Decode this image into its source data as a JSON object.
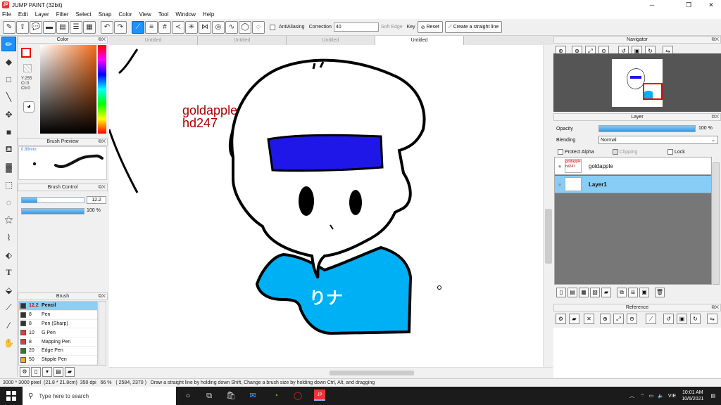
{
  "window": {
    "title": "JUMP PAINT (32bit)",
    "app_icon": "JP"
  },
  "menu": [
    "File",
    "Edit",
    "Layer",
    "Filter",
    "Select",
    "Snap",
    "Color",
    "View",
    "Tool",
    "Window",
    "Help"
  ],
  "toolbar": {
    "antialiasing_label": "AntiAliasing",
    "correction_label": "Correction",
    "correction_value": "40",
    "soft_edge_label": "Soft Edge",
    "key_label": "Key",
    "reset_label": "Reset",
    "straight_line_label": "Create a straight line"
  },
  "tabs": [
    "Untitled",
    "Untitled",
    "Untitled",
    "Untitled"
  ],
  "color_panel": {
    "title": "Color",
    "rgb": [
      "Y:255",
      "Cr:0",
      "Cb:0"
    ],
    "fg_color": "#ffffff",
    "accent": "#f26a18"
  },
  "brush_preview": {
    "title": "Brush Preview",
    "size": "0.89mm"
  },
  "brush_control": {
    "title": "Brush Control",
    "size": "12.2",
    "size_fraction": 0.25,
    "opacity": "100 %",
    "opacity_fraction": 1.0
  },
  "brush_panel": {
    "title": "Brush",
    "items": [
      {
        "size": "12.2",
        "name": "Pencil",
        "color": "#333333",
        "selected": true
      },
      {
        "size": "8",
        "name": "Pen",
        "color": "#333333",
        "selected": false
      },
      {
        "size": "8",
        "name": "Pen (Sharp)",
        "color": "#333333",
        "selected": false
      },
      {
        "size": "10",
        "name": "G Pen",
        "color": "#e53935",
        "selected": false
      },
      {
        "size": "8",
        "name": "Mapping Pen",
        "color": "#e53935",
        "selected": false
      },
      {
        "size": "20",
        "name": "Edge Pen",
        "color": "#2e7d32",
        "selected": false
      },
      {
        "size": "50",
        "name": "Stipple Pen",
        "color": "#f9a825",
        "selected": false
      }
    ]
  },
  "canvas": {
    "watermark_line1": "goldapple",
    "watermark_line2": "hd247",
    "drawing_text": "りナ",
    "headband_color": "#1f17e8",
    "shirt_color": "#00b0f5"
  },
  "navigator": {
    "title": "Navigator"
  },
  "layer_panel": {
    "title": "Layer",
    "opacity_label": "Opacity",
    "opacity_value": "100 %",
    "opacity_fraction": 1.0,
    "blending_label": "Blending",
    "blending_value": "Normal",
    "protect_alpha_label": "Protect Alpha",
    "clipping_label": "Clipping",
    "lock_label": "Lock",
    "layers": [
      {
        "name": "goldapple",
        "thumb_text": "goldapple hd247",
        "selected": false
      },
      {
        "name": "Layer1",
        "thumb_text": "",
        "selected": true
      }
    ]
  },
  "reference": {
    "title": "Reference"
  },
  "status": {
    "dimensions": "3000 * 3000 pixel",
    "size_cm": "(21.8 * 21.8cm)",
    "dpi": "350 dpi",
    "zoom": "66 %",
    "coords": "( 2584, 2370 )",
    "hint": "Draw a straight line by holding down Shift, Change a brush size by holding down Ctrl, Alt, and dragging"
  },
  "taskbar": {
    "search_placeholder": "Type here to search",
    "language": "VIE",
    "time": "10:01 AM",
    "date": "10/6/2021"
  }
}
